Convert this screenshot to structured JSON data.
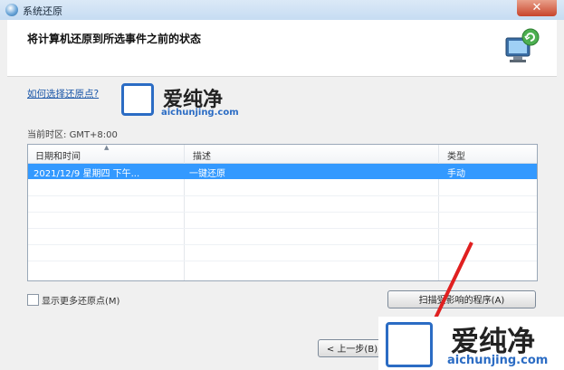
{
  "window": {
    "title": "系统还原",
    "close_glyph": "✕"
  },
  "header": {
    "heading": "将计算机还原到所选事件之前的状态"
  },
  "content": {
    "help_link": "如何选择还原点?",
    "timezone_label": "当前时区:",
    "timezone_value": "GMT+8:00",
    "columns": [
      "日期和时间",
      "描述",
      "类型"
    ],
    "rows": [
      {
        "date": "2021/12/9 星期四 下午...",
        "description": "一键还原",
        "type": "手动"
      }
    ],
    "show_more_label": "显示更多还原点(M)",
    "scan_button": "扫描受影响的程序(A)",
    "prev_button": "< 上一步(B)"
  },
  "watermark": {
    "brand": "爱纯净",
    "site": "aichunjing.com"
  },
  "colors": {
    "selection": "#3399ff",
    "arrow": "#e02020",
    "link": "#1a56a8"
  },
  "icons": [
    "system-restore-icon",
    "computer-restore-icon",
    "sort-ascending-icon",
    "close-icon"
  ]
}
